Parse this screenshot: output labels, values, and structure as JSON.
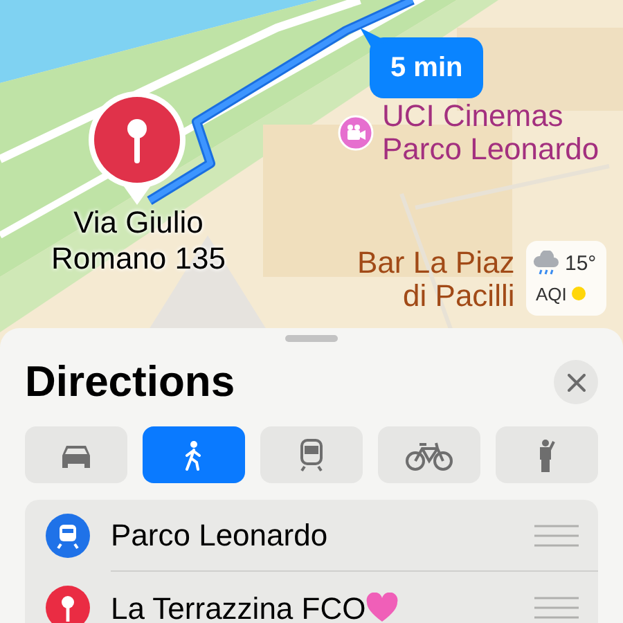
{
  "map": {
    "route_time": "5 min",
    "destination_pin": {
      "label_lines": [
        "Via Giulio",
        "Romano 135"
      ]
    },
    "places": [
      {
        "kind": "cinema",
        "lines": [
          "UCI Cinemas",
          "Parco Leonardo"
        ]
      },
      {
        "kind": "bar",
        "lines": [
          "Bar La Piaz",
          "di Pacilli"
        ]
      }
    ],
    "weather": {
      "temperature": "15°",
      "aqi_label": "AQI"
    }
  },
  "sheet": {
    "title": "Directions",
    "modes": [
      {
        "kind": "car",
        "selected": false
      },
      {
        "kind": "walk",
        "selected": true
      },
      {
        "kind": "transit",
        "selected": false
      },
      {
        "kind": "bike",
        "selected": false
      },
      {
        "kind": "ride",
        "selected": false
      }
    ],
    "waypoints": [
      {
        "kind": "transit",
        "name": "Parco Leonardo",
        "heart": false
      },
      {
        "kind": "pin",
        "name": "La Terrazzina FCO",
        "heart": true
      }
    ]
  }
}
